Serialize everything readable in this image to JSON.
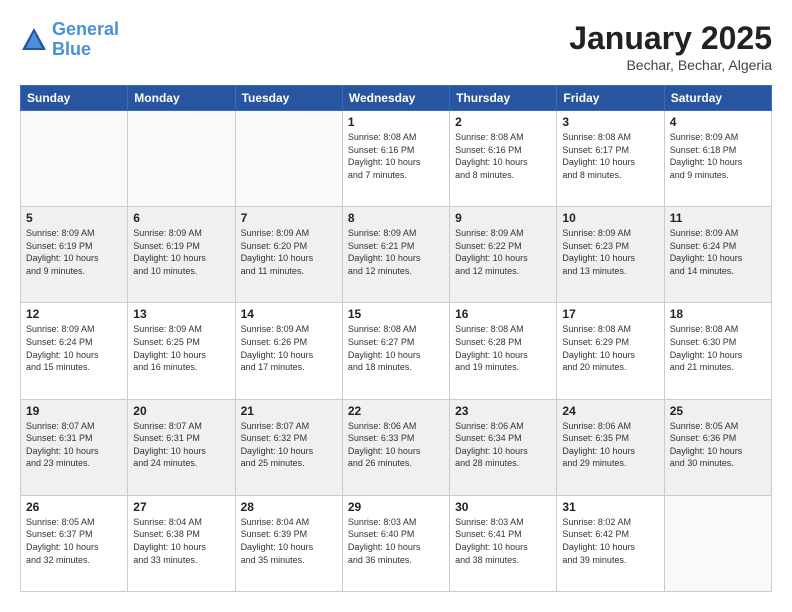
{
  "header": {
    "logo_line1": "General",
    "logo_line2": "Blue",
    "month_title": "January 2025",
    "subtitle": "Bechar, Bechar, Algeria"
  },
  "days_of_week": [
    "Sunday",
    "Monday",
    "Tuesday",
    "Wednesday",
    "Thursday",
    "Friday",
    "Saturday"
  ],
  "weeks": [
    [
      {
        "num": "",
        "info": ""
      },
      {
        "num": "",
        "info": ""
      },
      {
        "num": "",
        "info": ""
      },
      {
        "num": "1",
        "info": "Sunrise: 8:08 AM\nSunset: 6:16 PM\nDaylight: 10 hours\nand 7 minutes."
      },
      {
        "num": "2",
        "info": "Sunrise: 8:08 AM\nSunset: 6:16 PM\nDaylight: 10 hours\nand 8 minutes."
      },
      {
        "num": "3",
        "info": "Sunrise: 8:08 AM\nSunset: 6:17 PM\nDaylight: 10 hours\nand 8 minutes."
      },
      {
        "num": "4",
        "info": "Sunrise: 8:09 AM\nSunset: 6:18 PM\nDaylight: 10 hours\nand 9 minutes."
      }
    ],
    [
      {
        "num": "5",
        "info": "Sunrise: 8:09 AM\nSunset: 6:19 PM\nDaylight: 10 hours\nand 9 minutes."
      },
      {
        "num": "6",
        "info": "Sunrise: 8:09 AM\nSunset: 6:19 PM\nDaylight: 10 hours\nand 10 minutes."
      },
      {
        "num": "7",
        "info": "Sunrise: 8:09 AM\nSunset: 6:20 PM\nDaylight: 10 hours\nand 11 minutes."
      },
      {
        "num": "8",
        "info": "Sunrise: 8:09 AM\nSunset: 6:21 PM\nDaylight: 10 hours\nand 12 minutes."
      },
      {
        "num": "9",
        "info": "Sunrise: 8:09 AM\nSunset: 6:22 PM\nDaylight: 10 hours\nand 12 minutes."
      },
      {
        "num": "10",
        "info": "Sunrise: 8:09 AM\nSunset: 6:23 PM\nDaylight: 10 hours\nand 13 minutes."
      },
      {
        "num": "11",
        "info": "Sunrise: 8:09 AM\nSunset: 6:24 PM\nDaylight: 10 hours\nand 14 minutes."
      }
    ],
    [
      {
        "num": "12",
        "info": "Sunrise: 8:09 AM\nSunset: 6:24 PM\nDaylight: 10 hours\nand 15 minutes."
      },
      {
        "num": "13",
        "info": "Sunrise: 8:09 AM\nSunset: 6:25 PM\nDaylight: 10 hours\nand 16 minutes."
      },
      {
        "num": "14",
        "info": "Sunrise: 8:09 AM\nSunset: 6:26 PM\nDaylight: 10 hours\nand 17 minutes."
      },
      {
        "num": "15",
        "info": "Sunrise: 8:08 AM\nSunset: 6:27 PM\nDaylight: 10 hours\nand 18 minutes."
      },
      {
        "num": "16",
        "info": "Sunrise: 8:08 AM\nSunset: 6:28 PM\nDaylight: 10 hours\nand 19 minutes."
      },
      {
        "num": "17",
        "info": "Sunrise: 8:08 AM\nSunset: 6:29 PM\nDaylight: 10 hours\nand 20 minutes."
      },
      {
        "num": "18",
        "info": "Sunrise: 8:08 AM\nSunset: 6:30 PM\nDaylight: 10 hours\nand 21 minutes."
      }
    ],
    [
      {
        "num": "19",
        "info": "Sunrise: 8:07 AM\nSunset: 6:31 PM\nDaylight: 10 hours\nand 23 minutes."
      },
      {
        "num": "20",
        "info": "Sunrise: 8:07 AM\nSunset: 6:31 PM\nDaylight: 10 hours\nand 24 minutes."
      },
      {
        "num": "21",
        "info": "Sunrise: 8:07 AM\nSunset: 6:32 PM\nDaylight: 10 hours\nand 25 minutes."
      },
      {
        "num": "22",
        "info": "Sunrise: 8:06 AM\nSunset: 6:33 PM\nDaylight: 10 hours\nand 26 minutes."
      },
      {
        "num": "23",
        "info": "Sunrise: 8:06 AM\nSunset: 6:34 PM\nDaylight: 10 hours\nand 28 minutes."
      },
      {
        "num": "24",
        "info": "Sunrise: 8:06 AM\nSunset: 6:35 PM\nDaylight: 10 hours\nand 29 minutes."
      },
      {
        "num": "25",
        "info": "Sunrise: 8:05 AM\nSunset: 6:36 PM\nDaylight: 10 hours\nand 30 minutes."
      }
    ],
    [
      {
        "num": "26",
        "info": "Sunrise: 8:05 AM\nSunset: 6:37 PM\nDaylight: 10 hours\nand 32 minutes."
      },
      {
        "num": "27",
        "info": "Sunrise: 8:04 AM\nSunset: 6:38 PM\nDaylight: 10 hours\nand 33 minutes."
      },
      {
        "num": "28",
        "info": "Sunrise: 8:04 AM\nSunset: 6:39 PM\nDaylight: 10 hours\nand 35 minutes."
      },
      {
        "num": "29",
        "info": "Sunrise: 8:03 AM\nSunset: 6:40 PM\nDaylight: 10 hours\nand 36 minutes."
      },
      {
        "num": "30",
        "info": "Sunrise: 8:03 AM\nSunset: 6:41 PM\nDaylight: 10 hours\nand 38 minutes."
      },
      {
        "num": "31",
        "info": "Sunrise: 8:02 AM\nSunset: 6:42 PM\nDaylight: 10 hours\nand 39 minutes."
      },
      {
        "num": "",
        "info": ""
      }
    ]
  ]
}
